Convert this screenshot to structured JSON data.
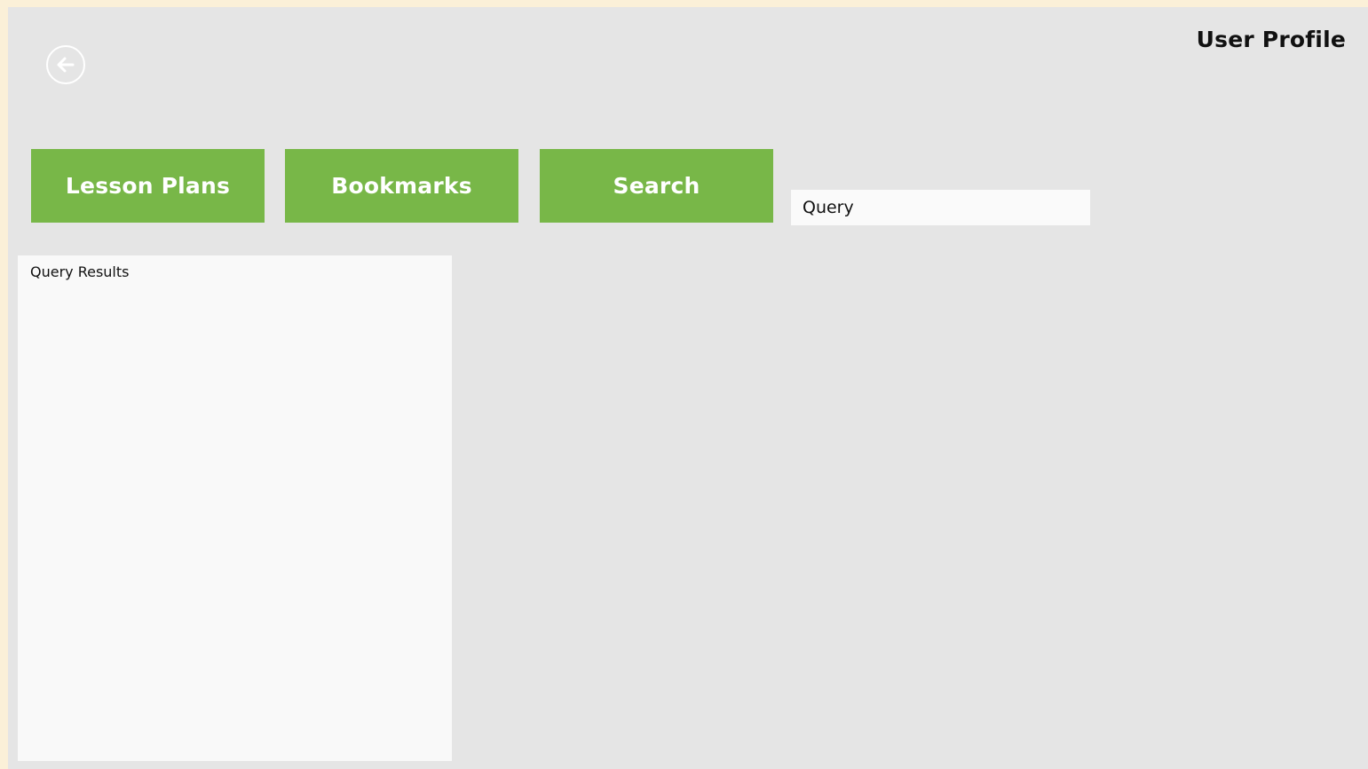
{
  "header": {
    "title": "User Profile",
    "back_icon": "arrow-left-circle-icon"
  },
  "tiles": [
    {
      "label": "Lesson Plans"
    },
    {
      "label": "Bookmarks"
    },
    {
      "label": "Search"
    }
  ],
  "search": {
    "placeholder": "Query",
    "value": ""
  },
  "results": {
    "label": "Query Results"
  },
  "colors": {
    "tile_green": "#78b748",
    "app_background": "#e5e5e5",
    "panel_background": "#f9f9f9",
    "outer_background": "#fbf0d8"
  }
}
